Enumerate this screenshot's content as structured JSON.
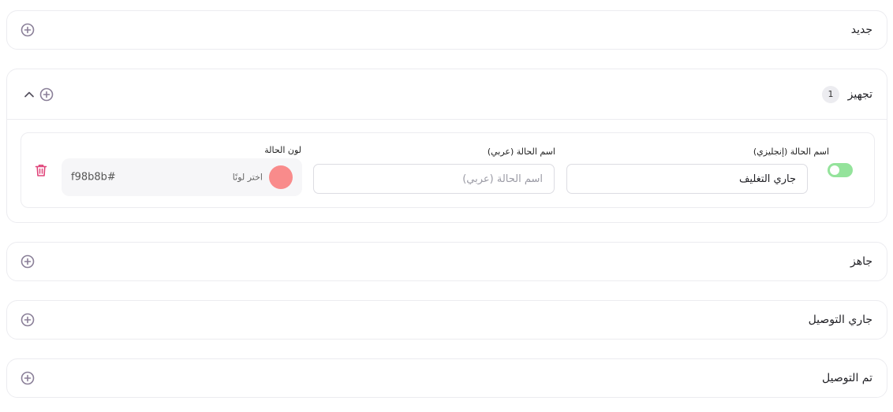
{
  "colors": {
    "accent_icon": "#8a7f98",
    "toggle_on": "#94e39b",
    "trash": "#e0457a",
    "status_color": "#f98b8b"
  },
  "statuses": [
    {
      "title": "جديد",
      "expanded": false,
      "icon": "plus-circle-icon"
    },
    {
      "title": "تجهيز",
      "count": "1",
      "expanded": true,
      "icons": [
        "chevron-up-icon",
        "plus-circle-icon"
      ],
      "items": [
        {
          "enabled": true,
          "name_en_label": "اسم الحالة (إنجليزي)",
          "name_en_value": "جاري التغليف",
          "name_ar_label": "اسم الحالة (عربي)",
          "name_ar_placeholder": "اسم الحالة (عربي)",
          "name_ar_value": "",
          "color_label": "لون الحالة",
          "color_pick_label": "اختر لونًا",
          "color_hex": "f98b8b#",
          "delete_icon": "trash-icon"
        }
      ]
    },
    {
      "title": "جاهز",
      "expanded": false,
      "icon": "plus-circle-icon"
    },
    {
      "title": "جاري التوصيل",
      "expanded": false,
      "icon": "plus-circle-icon"
    },
    {
      "title": "تم التوصيل",
      "expanded": false,
      "icon": "plus-circle-icon"
    }
  ]
}
